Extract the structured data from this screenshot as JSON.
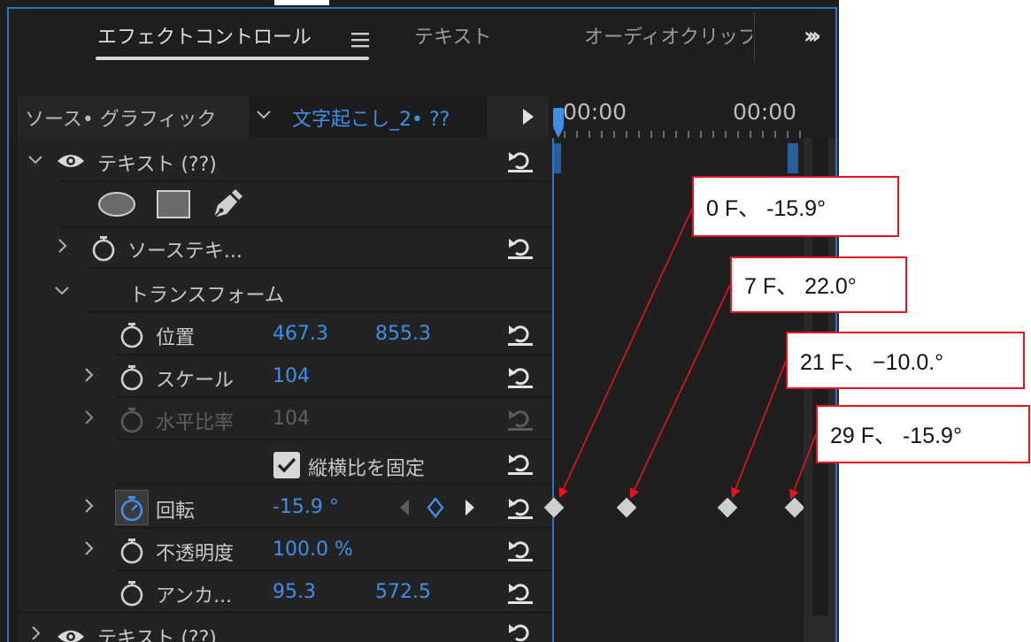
{
  "tabs": {
    "effect_controls": "エフェクトコントロール",
    "text": "テキスト",
    "audio_clip": "オーディオクリップ"
  },
  "source": {
    "label": "ソース• グラフィック",
    "clip_name": "文字起こし_2• ??"
  },
  "timecodes": [
    "00:00",
    "00:00"
  ],
  "rows": {
    "text_group": "テキスト (??)",
    "source_text": "ソーステキ...",
    "transform": "トランスフォーム",
    "position": {
      "label": "位置",
      "x": "467.3",
      "y": "855.3"
    },
    "scale": {
      "label": "スケール",
      "value": "104"
    },
    "scale_width": {
      "label": "水平比率",
      "value": "104"
    },
    "uniform_scale": {
      "label": "縦横比を固定",
      "checked": true
    },
    "rotation": {
      "label": "回転",
      "value": "-15.9 °"
    },
    "opacity": {
      "label": "不透明度",
      "value": "100.0 %"
    },
    "anchor": {
      "label": "アンカ...",
      "x": "95.3",
      "y": "572.5"
    },
    "text_group_2": "テキスト (??)"
  },
  "annotations": [
    {
      "text": "0 F、 -15.9°"
    },
    {
      "text": "7 F、 22.0°"
    },
    {
      "text": "21 F、 −10.0.°"
    },
    {
      "text": "29 F、 -15.9°"
    }
  ],
  "colors": {
    "accent": "#3f8fe8",
    "panel_border": "#2f76c8",
    "annotation_border": "#e8131c"
  },
  "icons": [
    "menu-icon",
    "overflow-icon",
    "chevron-down-icon",
    "play-icon",
    "eye-icon",
    "stopwatch-icon",
    "reset-icon",
    "ellipse-tool-icon",
    "rectangle-tool-icon",
    "pen-tool-icon",
    "checkbox-icon",
    "keyframe-icon"
  ]
}
